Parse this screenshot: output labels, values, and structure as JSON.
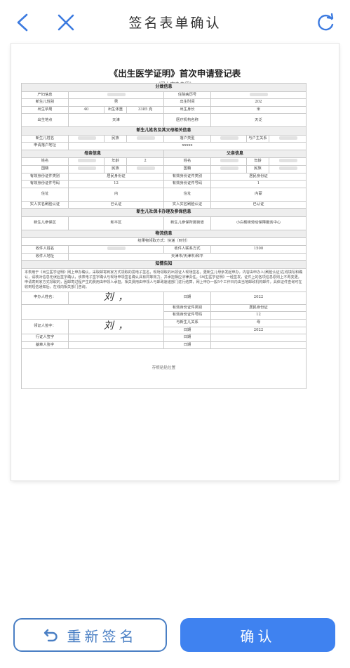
{
  "header": {
    "title": "签名表单确认",
    "back_icon": "chevron-left-icon",
    "close_icon": "close-icon",
    "refresh_icon": "refresh-icon"
  },
  "doc": {
    "title": "《出生医学证明》首次申请登记表",
    "subtitle": "（网上申办专用）",
    "sec_birth": "分娩信息",
    "birth": {
      "l1": "产妇信息",
      "l2": "住院病历号",
      "l3": "新生儿性别",
      "v3": "男",
      "l4": "出生时间",
      "v4": "202",
      "l5": "出生孕周",
      "v5": "40",
      "l6": "出生体重",
      "v6": "3385 克",
      "l7": "出生身长",
      "v7": "米",
      "l8": "出生地点",
      "v8": "天津",
      "l9": "医疗机构名称",
      "v9": "天泛"
    },
    "sec_name": "新生儿姓名及其父母相关信息",
    "name": {
      "l1": "新生儿姓名",
      "l2": "民族",
      "l3": "落户类型",
      "l4": "与户主关系",
      "l5": "申请落户地址",
      "v5": "xxxxx"
    },
    "sec_mother": "母亲信息",
    "sec_father": "父亲信息",
    "parents": {
      "name": "姓名",
      "age": "年龄",
      "mage": "2",
      "nation": "国籍",
      "ethnic": "民族",
      "idtype": "有效身份证件类别",
      "idtype_v": "居民身份证",
      "idno": "有效身份证件号码",
      "m_idno": "12",
      "f_idno": "1",
      "addr": "住址",
      "m_addr": "内",
      "f_addr": "内蒙",
      "verify": "实人实名刷脸认证",
      "verify_v": "已认证"
    },
    "sec_social": "新生儿社保卡办理及参保信息",
    "social": {
      "l1": "新生儿参保区",
      "v1": "和平区",
      "l2": "新生儿参保所属街道",
      "v2": "小白楼街劳动保障服务中心"
    },
    "sec_logistics": "物流信息",
    "logistics": {
      "method": "结果物领取方式：快递（到付）",
      "l1": "收件人姓名",
      "l2": "收件人联系方式",
      "v2": "1500",
      "l3": "收件人地址",
      "v3": "天津市/天津市/和平"
    },
    "notice_title": "知情告知",
    "notice_text": "本表用于《出生医学证明》网上申办确认，采取邮寄到家方式领取的需电子签名，现场领取的出领证人现场签名。更新生儿母亲发起申办，内容由申办人(刷脸认证)在线填写和确认，请核对信息无误后签字确认，该表电子签字确认与现场申领签名确认具有同等效力，并承担相应法律责任。《出生医学证明》一经签发，证件上的各项信息原则上不再变更，申请寄到家方式领取的，因邮寄过程产生的费用由申领人承担，相关费用由申领人与邮政速递部门进行结算，网上申办一般5个工作日内由当地邮政机构邮件，具体证件查询可在收到短信通知后，在线向相关部门咨询。",
    "sign": {
      "applicant": "申办人姓名：",
      "signature": "刘  ，",
      "date": "日期",
      "date_v": "2022",
      "idtype": "有效身份证件类别",
      "idtype_v": "居民身份证",
      "idno": "有效身份证件号码",
      "idno_v": "12",
      "relation": "与新生儿关系",
      "relation_v": "母",
      "receiver": "领证人签字：",
      "date2_v": "2022",
      "issuer": "行证人签字",
      "reviewer": "基章人签字",
      "stamp": "存根粘贴位置"
    }
  },
  "footer": {
    "resign_label": "重新签名",
    "confirm_label": "确认",
    "resign_icon": "undo-icon"
  },
  "colors": {
    "primary": "#3f82f0",
    "outline": "#4a7fc4",
    "nav_icon": "#3d7be0"
  }
}
